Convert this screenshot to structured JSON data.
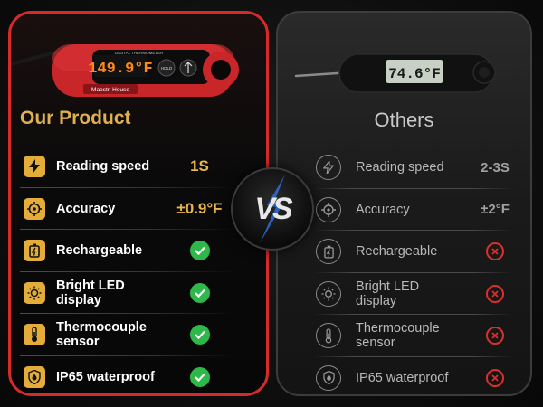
{
  "left_panel": {
    "title": "Our Product",
    "device": {
      "brand": "Maestri House",
      "reading": "149.9°F",
      "model_text": "DIGITAL THERMOMETER",
      "hold_label": "HOLD"
    },
    "rows": [
      {
        "label": "Reading speed",
        "value": "1S",
        "icon": "lightning-icon"
      },
      {
        "label": "Accuracy",
        "value": "±0.9°F",
        "icon": "target-icon"
      },
      {
        "label": "Rechargeable",
        "icon": "battery-icon",
        "status": "check"
      },
      {
        "label": "Bright LED display",
        "icon": "sun-icon",
        "status": "check"
      },
      {
        "label": "Thermocouple sensor",
        "icon": "thermometer-icon",
        "status": "check"
      },
      {
        "label": "IP65 waterproof",
        "icon": "water-drop-shield-icon",
        "status": "check"
      }
    ]
  },
  "right_panel": {
    "title": "Others",
    "device": {
      "reading": "74.6°F"
    },
    "rows": [
      {
        "label": "Reading speed",
        "value": "2-3S",
        "icon": "lightning-icon"
      },
      {
        "label": "Accuracy",
        "value": "±2°F",
        "icon": "target-icon"
      },
      {
        "label": "Rechargeable",
        "icon": "battery-icon",
        "status": "cross"
      },
      {
        "label": "Bright LED display",
        "icon": "sun-icon",
        "status": "cross"
      },
      {
        "label": "Thermocouple sensor",
        "icon": "thermometer-icon",
        "status": "cross"
      },
      {
        "label": "IP65 waterproof",
        "icon": "water-drop-shield-icon",
        "status": "cross"
      }
    ]
  },
  "vs_label": "VS",
  "colors": {
    "accent_red": "#d92a2a",
    "gold": "#e4ad3a",
    "check_green": "#2fb84a",
    "cross_red": "#d9302e"
  }
}
